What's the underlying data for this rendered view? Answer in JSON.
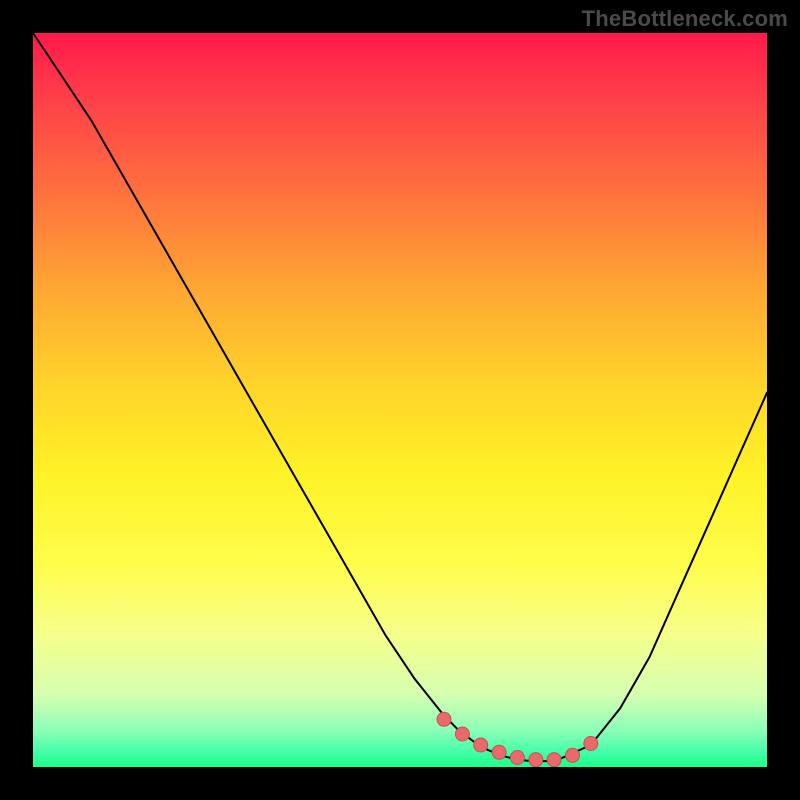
{
  "watermark": {
    "text": "TheBottleneck.com"
  },
  "colors": {
    "curve_stroke": "#000000",
    "marker_fill": "#e86a6a",
    "marker_stroke": "#c94f4f",
    "background": "#000000"
  },
  "chart_data": {
    "type": "line",
    "title": "",
    "xlabel": "",
    "ylabel": "",
    "xlim": [
      0,
      100
    ],
    "ylim": [
      0,
      100
    ],
    "grid": false,
    "legend": false,
    "series": [
      {
        "name": "bottleneck-curve",
        "x": [
          0,
          4,
          8,
          12,
          16,
          20,
          24,
          28,
          32,
          36,
          40,
          44,
          48,
          52,
          56,
          58,
          60,
          62,
          64,
          66,
          68,
          70,
          72,
          76,
          80,
          84,
          88,
          92,
          96,
          100
        ],
        "values": [
          100,
          94,
          88,
          81,
          74,
          67,
          60,
          53,
          46,
          39,
          32,
          25,
          18,
          12,
          7,
          5,
          3.5,
          2.3,
          1.5,
          1.0,
          0.8,
          0.8,
          1.2,
          3,
          8,
          15,
          24,
          33,
          42,
          51
        ]
      }
    ],
    "markers": {
      "name": "highlighted-region",
      "x": [
        56,
        58.5,
        61,
        63.5,
        66,
        68.5,
        71,
        73.5,
        76
      ],
      "values": [
        6.5,
        4.5,
        3.0,
        2.0,
        1.3,
        1.0,
        1.0,
        1.6,
        3.2
      ]
    }
  }
}
